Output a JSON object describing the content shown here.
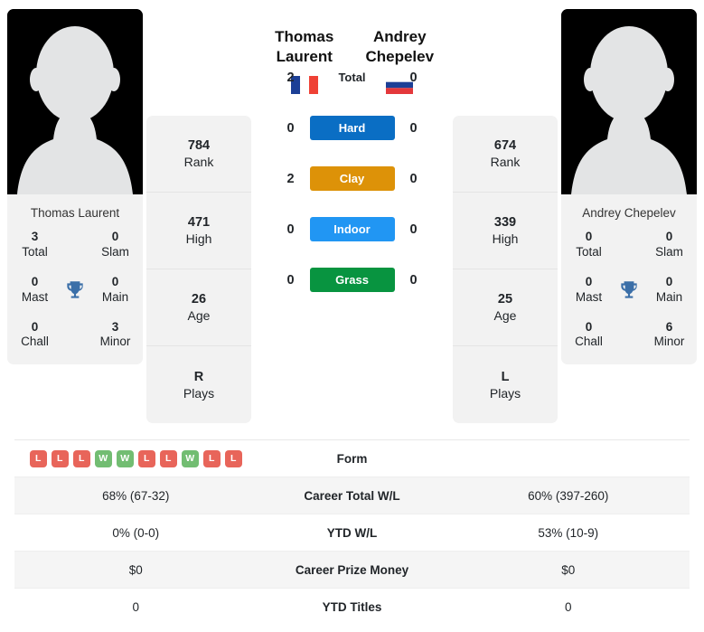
{
  "players": {
    "left": {
      "first_name": "Thomas",
      "last_name": "Laurent",
      "full_name": "Thomas Laurent",
      "country_code": "FR",
      "flag_name": "france-flag",
      "rank": "784",
      "rank_label": "Rank",
      "high": "471",
      "high_label": "High",
      "age": "26",
      "age_label": "Age",
      "plays": "R",
      "plays_label": "Plays",
      "titles": {
        "total": "3",
        "total_label": "Total",
        "slam": "0",
        "slam_label": "Slam",
        "mast": "0",
        "mast_label": "Mast",
        "main": "0",
        "main_label": "Main",
        "chall": "0",
        "chall_label": "Chall",
        "minor": "3",
        "minor_label": "Minor"
      }
    },
    "right": {
      "first_name": "Andrey",
      "last_name": "Chepelev",
      "full_name": "Andrey Chepelev",
      "country_code": "RU",
      "flag_name": "russia-flag",
      "rank": "674",
      "rank_label": "Rank",
      "high": "339",
      "high_label": "High",
      "age": "25",
      "age_label": "Age",
      "plays": "L",
      "plays_label": "Plays",
      "titles": {
        "total": "0",
        "total_label": "Total",
        "slam": "0",
        "slam_label": "Slam",
        "mast": "0",
        "mast_label": "Mast",
        "main": "0",
        "main_label": "Main",
        "chall": "0",
        "chall_label": "Chall",
        "minor": "6",
        "minor_label": "Minor"
      }
    }
  },
  "head_to_head": [
    {
      "label": "Total",
      "left": "2",
      "right": "0",
      "color": "",
      "plain": true
    },
    {
      "label": "Hard",
      "left": "0",
      "right": "0",
      "color": "#0a6ec4",
      "plain": false
    },
    {
      "label": "Clay",
      "left": "2",
      "right": "0",
      "color": "#dd9208",
      "plain": false
    },
    {
      "label": "Indoor",
      "left": "0",
      "right": "0",
      "color": "#2196f3",
      "plain": false
    },
    {
      "label": "Grass",
      "left": "0",
      "right": "0",
      "color": "#089440",
      "plain": false
    }
  ],
  "comparison_table": {
    "form_row": {
      "label": "Form",
      "left_form": [
        "L",
        "L",
        "L",
        "W",
        "W",
        "L",
        "L",
        "W",
        "L",
        "L"
      ],
      "right_form": []
    },
    "rows": [
      {
        "label": "Career Total W/L",
        "left": "68% (67-32)",
        "right": "60% (397-260)"
      },
      {
        "label": "YTD W/L",
        "left": "0% (0-0)",
        "right": "53% (10-9)"
      },
      {
        "label": "Career Prize Money",
        "left": "$0",
        "right": "$0"
      },
      {
        "label": "YTD Titles",
        "left": "0",
        "right": "0"
      }
    ]
  },
  "colors": {
    "win": "#72bd72",
    "loss": "#e8655a",
    "trophy": "#3b6fa8",
    "panel_bg": "#f2f2f2",
    "stripe_bg": "#f5f5f5"
  },
  "icons": {
    "trophy": "trophy-icon",
    "avatar": "player-avatar-silhouette"
  }
}
